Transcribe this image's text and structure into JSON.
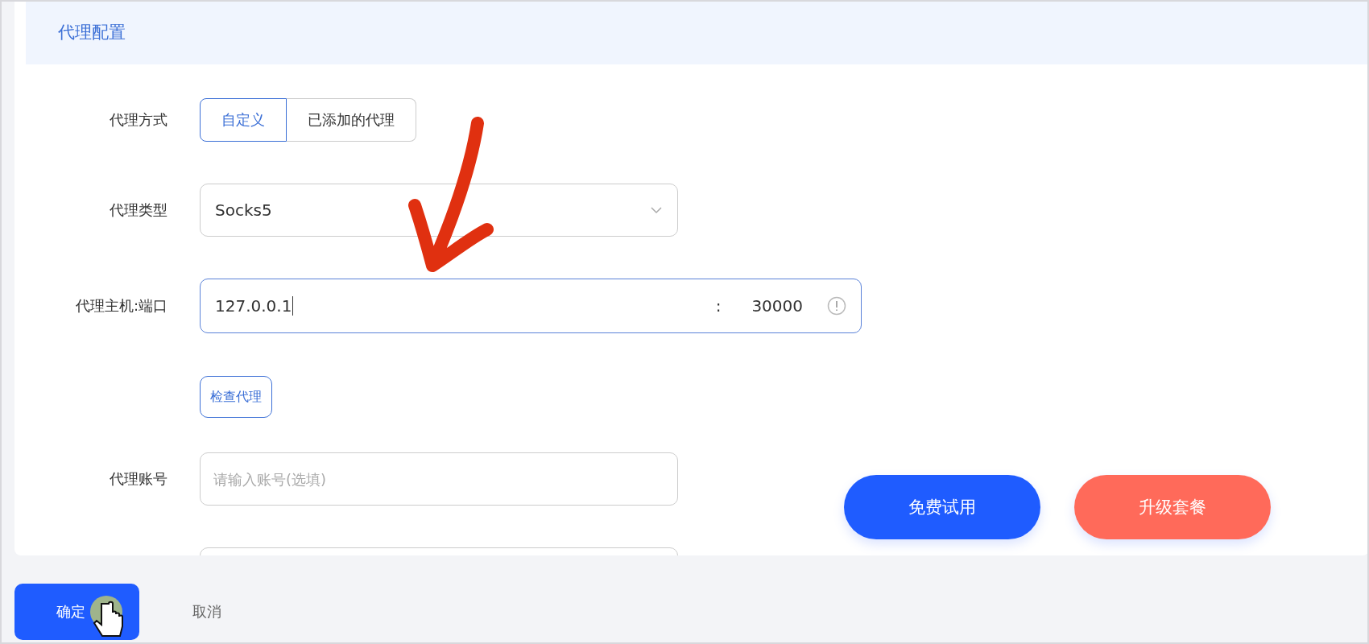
{
  "panel": {
    "title": "代理配置"
  },
  "rows": [
    {
      "kind": "segmented",
      "label": "代理方式",
      "options": [
        {
          "label": "自定义",
          "selected": true
        },
        {
          "label": "已添加的代理",
          "selected": false
        }
      ]
    },
    {
      "kind": "select",
      "label": "代理类型",
      "value": "Socks5"
    },
    {
      "kind": "hostport",
      "label": "代理主机:端口",
      "host": "127.0.0.1",
      "separator": ":",
      "port": "30000",
      "focused": true
    },
    {
      "kind": "button",
      "label": "检查代理"
    },
    {
      "kind": "input",
      "label": "代理账号",
      "placeholder": "请输入账号(选填)"
    },
    {
      "kind": "clipped"
    }
  ],
  "promo_buttons": [
    {
      "label": "免费试用",
      "color": "#1f5cff"
    },
    {
      "label": "升级套餐",
      "color": "#ff6a5a"
    }
  ],
  "footer": {
    "confirm": "确定",
    "cancel": "取消"
  }
}
